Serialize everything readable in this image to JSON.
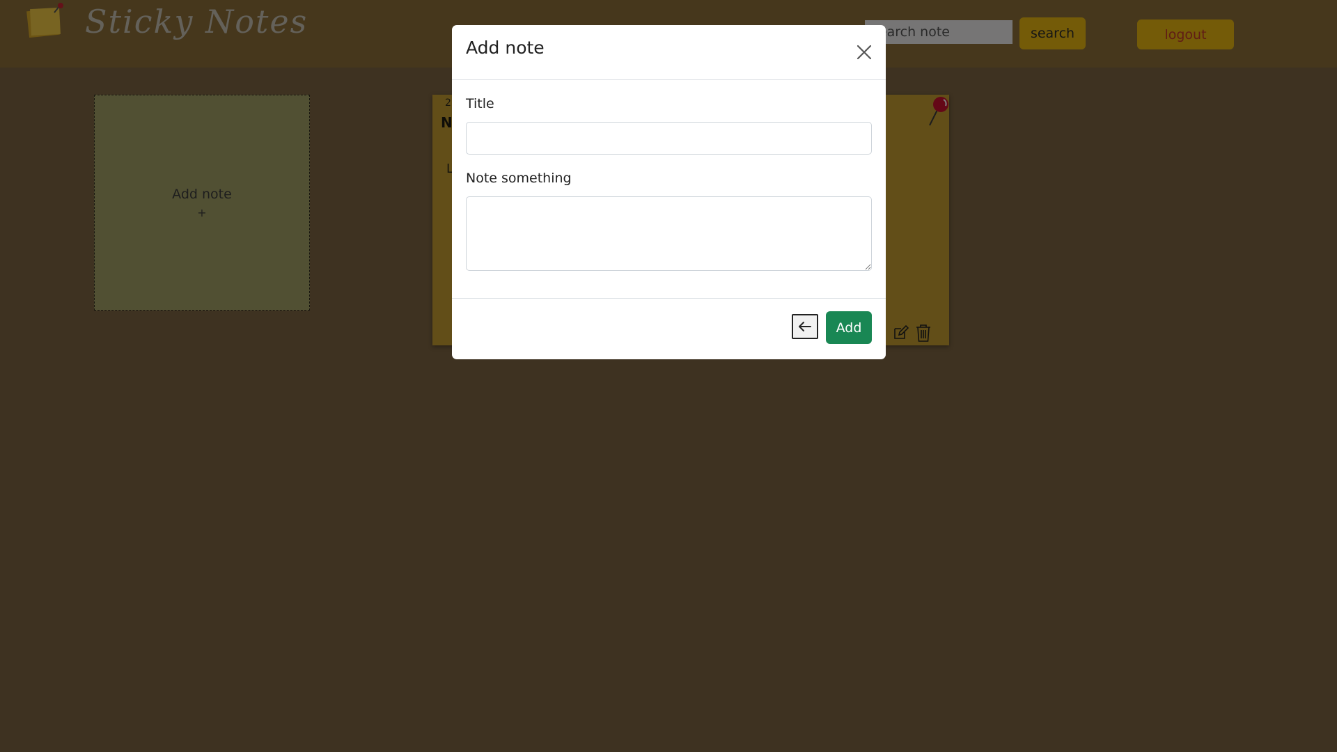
{
  "header": {
    "app_title": "Sticky Notes",
    "search_placeholder": "search note",
    "search_label": "search",
    "logout_label": "logout"
  },
  "board": {
    "add_card": {
      "label": "Add note",
      "plus": "+"
    },
    "note": {
      "date": "2",
      "title": "N",
      "body": "L"
    }
  },
  "modal": {
    "title": "Add note",
    "title_label": "Title",
    "title_value": "",
    "note_label": "Note something",
    "note_value": "",
    "add_label": "Add"
  },
  "icons": {
    "logo": "sticky-note-logo-icon",
    "pin": "pushpin-icon",
    "edit": "edit-icon",
    "delete": "trash-icon",
    "close": "close-icon",
    "back": "arrow-left-icon"
  },
  "colors": {
    "accent_yellow": "#e8b711",
    "logout_text": "#c0392b",
    "add_button": "#198754",
    "add_card_bg": "#a3a067",
    "note_bg": "#c59d31"
  }
}
